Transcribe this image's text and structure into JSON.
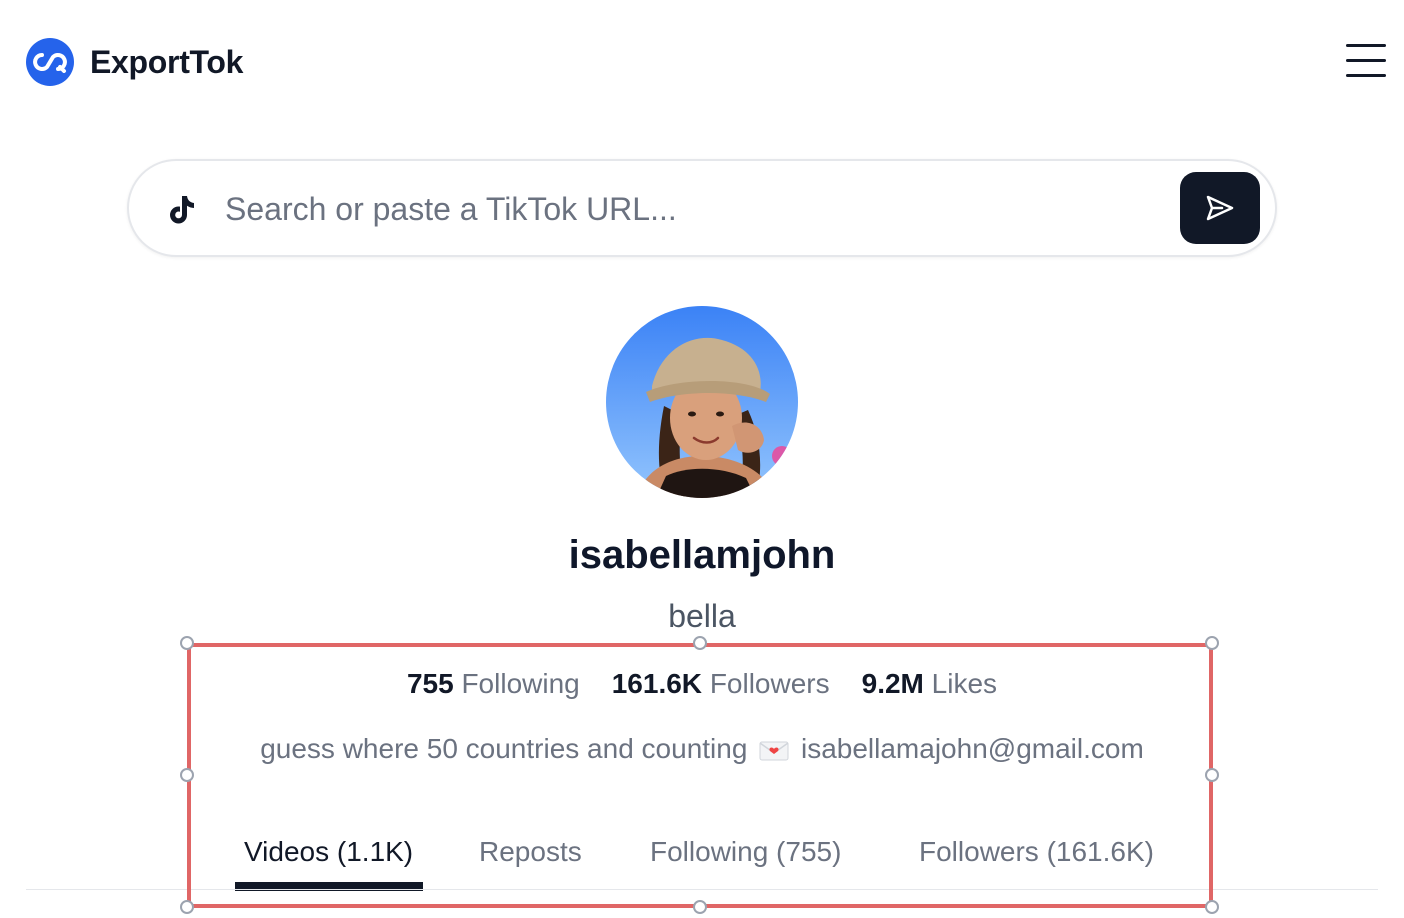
{
  "header": {
    "brand_name": "ExportTok",
    "menu_icon": "hamburger-menu-icon"
  },
  "search": {
    "placeholder": "Search or paste a TikTok URL...",
    "value": "",
    "submit_icon": "send-icon"
  },
  "profile": {
    "username": "isabellamjohn",
    "nickname": "bella",
    "stats": {
      "following_count": "755",
      "following_label": "Following",
      "followers_count": "161.6K",
      "followers_label": "Followers",
      "likes_count": "9.2M",
      "likes_label": "Likes"
    },
    "bio_text": "guess where 50 countries and counting",
    "bio_email": "isabellamajohn@gmail.com"
  },
  "tabs": [
    {
      "label": "Videos (1.1K)",
      "active": true
    },
    {
      "label": "Reposts",
      "active": false
    },
    {
      "label": "Following (755)",
      "active": false
    },
    {
      "label": "Followers (161.6K)",
      "active": false
    }
  ],
  "colors": {
    "brand_blue": "#2563eb",
    "dark": "#111827",
    "muted": "#6b7280",
    "selection_red": "#e06666"
  }
}
